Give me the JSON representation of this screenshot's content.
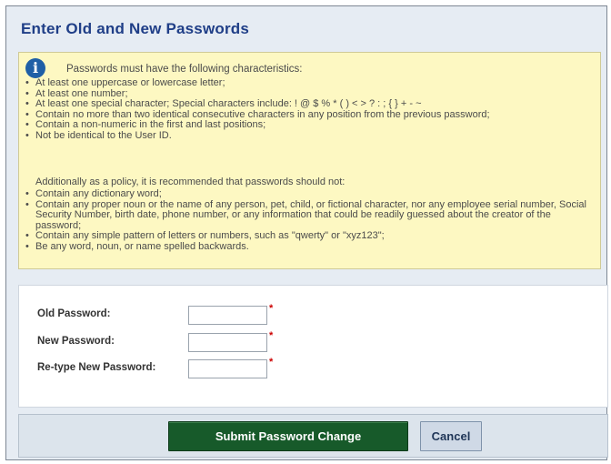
{
  "dialog": {
    "title": "Enter Old and New Passwords"
  },
  "info": {
    "icon": "info-icon",
    "icon_glyph": "i",
    "intro": "Passwords must have the following characteristics:",
    "requirements": [
      "At least one uppercase or lowercase letter;",
      "At least one number;",
      "At least one special character; Special characters include: ! @ $ % * ( ) < > ? : ; { } + - ~",
      "Contain no more than two identical consecutive characters in any position from the previous password;",
      "Contain a non-numeric in the first and last positions;",
      "Not be identical to the User ID."
    ],
    "policy_intro": "Additionally as a policy, it is recommended that passwords should not:",
    "recommendations": [
      "Contain any dictionary word;",
      "Contain any proper noun or the name of any person, pet, child, or fictional character, nor any employee serial number, Social Security Number, birth date, phone number, or any information that could be readily guessed about the creator of the password;",
      "Contain any simple pattern of letters or numbers, such as \"qwerty\" or \"xyz123\";",
      "Be any word, noun, or name spelled backwards."
    ]
  },
  "form": {
    "old_password": {
      "label": "Old Password:",
      "value": ""
    },
    "new_password": {
      "label": "New Password:",
      "value": ""
    },
    "retype_password": {
      "label": "Re-type New Password:",
      "value": ""
    },
    "required_marker": "*"
  },
  "buttons": {
    "submit_label": "Submit Password Change",
    "cancel_label": "Cancel"
  },
  "colors": {
    "title": "#1f3e87",
    "info_background": "#fdf8c2",
    "submit_background": "#175a2a",
    "required": "#cc0000"
  }
}
